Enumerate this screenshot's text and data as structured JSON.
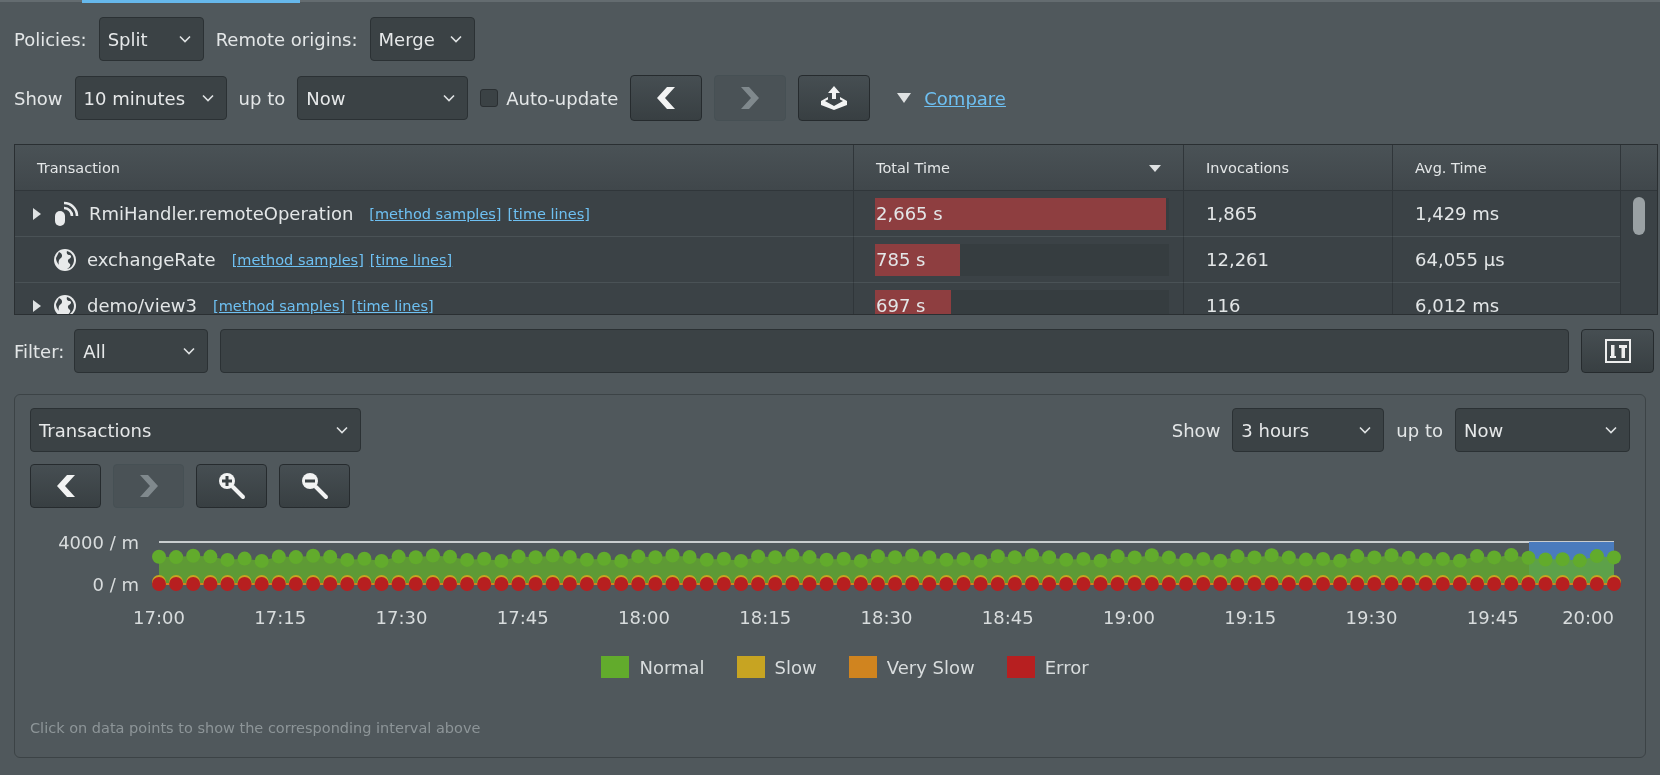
{
  "toolbar": {
    "policies": {
      "label": "Policies:",
      "value": "Split"
    },
    "remote_origins": {
      "label": "Remote origins:",
      "value": "Merge"
    }
  },
  "time_range": {
    "show_label": "Show",
    "duration": "10 minutes",
    "up_to_label": "up to",
    "end": "Now",
    "auto_update": {
      "label": "Auto-update",
      "checked": false
    },
    "buttons": [
      {
        "kind": "back",
        "disabled": false
      },
      {
        "kind": "forward",
        "disabled": true
      },
      {
        "kind": "export",
        "disabled": false
      }
    ],
    "compare": {
      "label": "Compare"
    }
  },
  "table": {
    "columns": [
      {
        "label": "Transaction",
        "sorted": false
      },
      {
        "label": "Total Time",
        "sorted": true
      },
      {
        "label": "Invocations",
        "sorted": false
      },
      {
        "label": "Avg. Time",
        "sorted": false
      }
    ],
    "rows": [
      {
        "expandable": true,
        "kind": "rmi",
        "name": "RmiHandler.remoteOperation",
        "links": [
          "[method samples]",
          "[time lines]"
        ],
        "total_time": "2,665 s",
        "level": 0.99,
        "invocations": "1,865",
        "avg_time": "1,429 ms"
      },
      {
        "expandable": false,
        "kind": "web",
        "name": "exchangeRate",
        "links": [
          "[method samples]",
          "[time lines]"
        ],
        "total_time": "785 s",
        "level": 0.29,
        "invocations": "12,261",
        "avg_time": "64,055 µs"
      },
      {
        "expandable": true,
        "kind": "web",
        "name": "demo/view3",
        "links": [
          "[method samples]",
          "[time lines]"
        ],
        "total_time": "697 s",
        "level": 0.26,
        "invocations": "116",
        "avg_time": "6,012 ms"
      }
    ]
  },
  "filter": {
    "label": "Filter:",
    "mode": "All"
  },
  "chart_panel": {
    "metric": "Transactions",
    "show_label": "Show",
    "duration": "3 hours",
    "up_to_label": "up to",
    "end": "Now",
    "buttons": [
      {
        "kind": "back",
        "disabled": false
      },
      {
        "kind": "forward",
        "disabled": true
      },
      {
        "kind": "zoom-in",
        "disabled": false
      },
      {
        "kind": "zoom-out",
        "disabled": false
      }
    ],
    "y_axis_labels": [
      "4000 / m",
      "0 / m"
    ],
    "x_axis_labels": [
      "17:00",
      "17:15",
      "17:30",
      "17:45",
      "18:00",
      "18:15",
      "18:30",
      "18:45",
      "19:00",
      "19:15",
      "19:30",
      "19:45",
      "20:00"
    ],
    "legend": [
      {
        "label": "Normal",
        "color": "#62ab2c"
      },
      {
        "label": "Slow",
        "color": "#c7a422"
      },
      {
        "label": "Very Slow",
        "color": "#d0841f"
      },
      {
        "label": "Error",
        "color": "#b71f20"
      }
    ],
    "hint": "Click on data points to show the corresponding interval above"
  }
}
